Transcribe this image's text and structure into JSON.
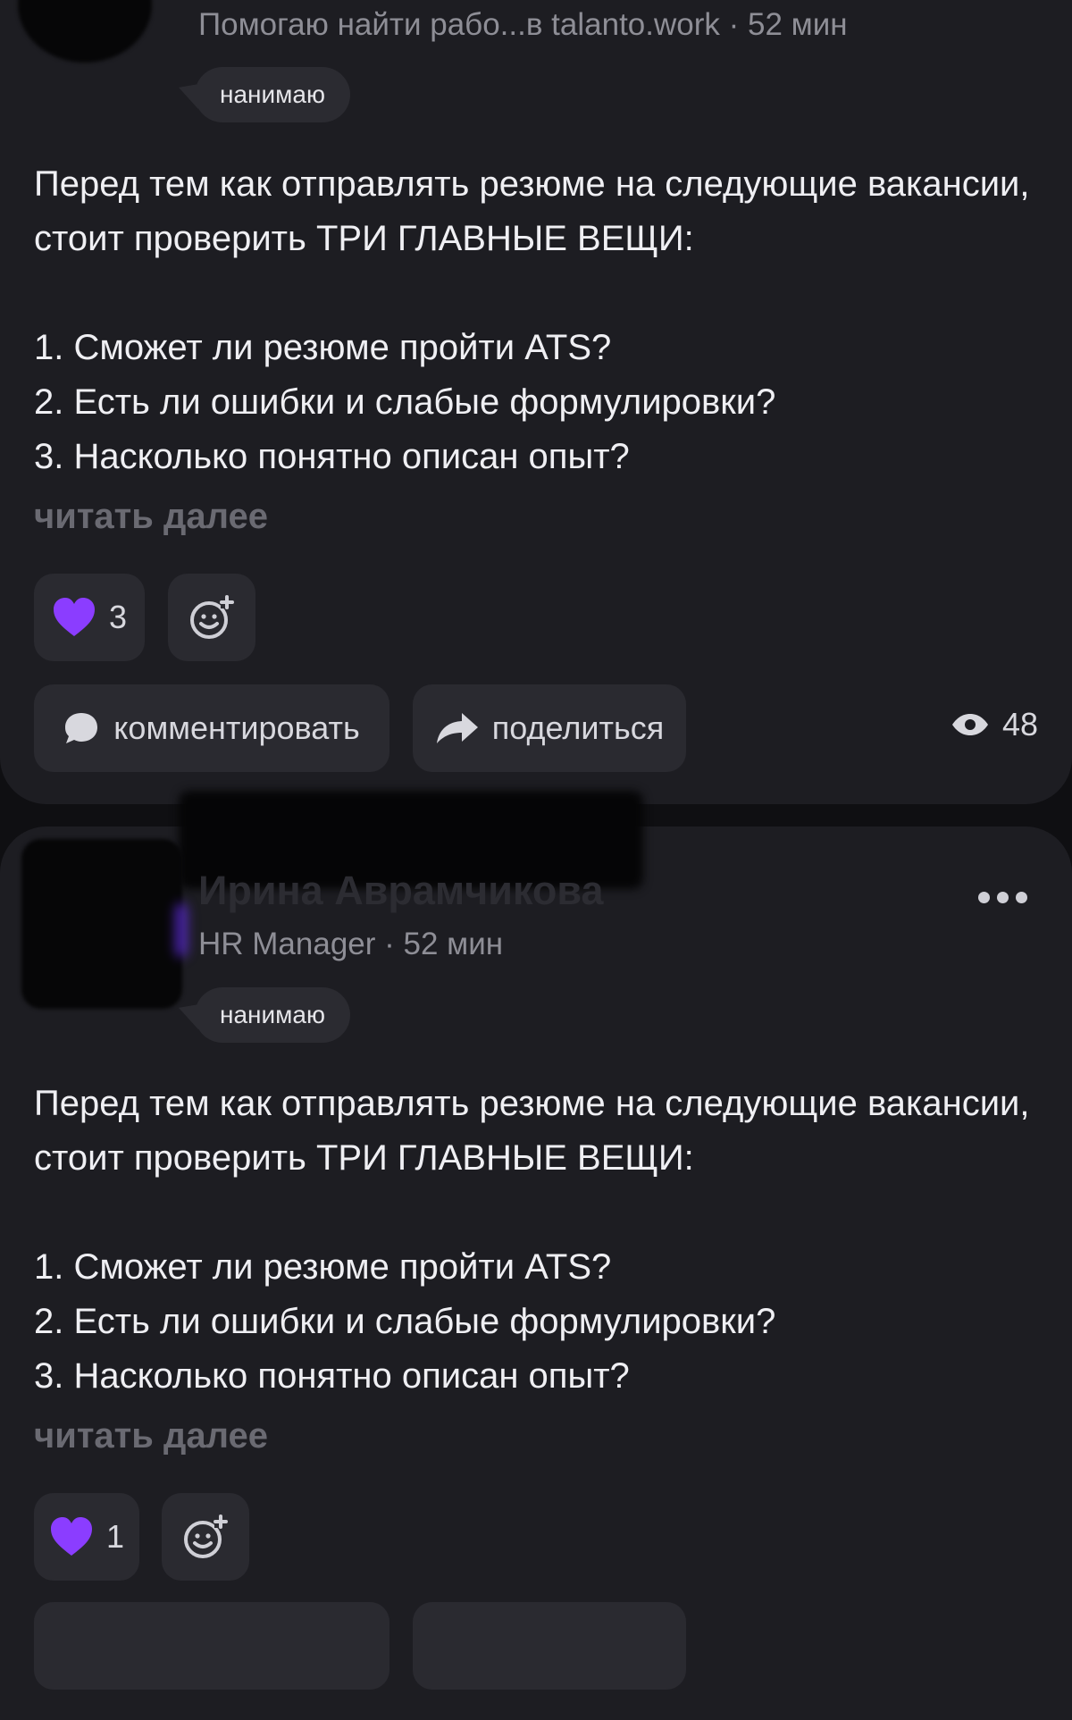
{
  "posts": [
    {
      "author_subtitle": "Помогаю найти рабо...в talanto.work · 52 мин",
      "tag": "нанимаю",
      "body_intro": "Перед тем как отправлять резюме на следующие вакансии, стоит проверить ТРИ ГЛАВНЫЕ ВЕЩИ:",
      "points": [
        "1. Сможет ли резюме пройти ATS?",
        "2. Есть ли ошибки и слабые формулировки?",
        "3. Насколько понятно описан опыт?"
      ],
      "read_more": "читать далее",
      "likes": "3",
      "comment_label": "комментировать",
      "share_label": "поделиться",
      "views": "48"
    },
    {
      "author_name": "Ирина Аврамчикова",
      "author_subtitle": "HR Manager · 52 мин",
      "tag": "нанимаю",
      "body_intro": "Перед тем как отправлять резюме на следующие вакансии, стоит проверить ТРИ ГЛАВНЫЕ ВЕЩИ:",
      "points": [
        "1. Сможет ли резюме пройти ATS?",
        "2. Есть ли ошибки и слабые формулировки?",
        "3. Насколько понятно описан опыт?"
      ],
      "read_more": "читать далее",
      "likes": "1"
    }
  ],
  "icons": {
    "heart": "heart-icon",
    "add_reaction": "add-reaction-icon",
    "comment": "comment-icon",
    "share": "share-icon",
    "eye": "eye-icon",
    "more": "more-options-icon"
  },
  "colors": {
    "background": "#0f0f12",
    "card": "#1d1d22",
    "pill": "#2a2a30",
    "heart": "#8b3dff",
    "muted": "#8e8e96"
  }
}
